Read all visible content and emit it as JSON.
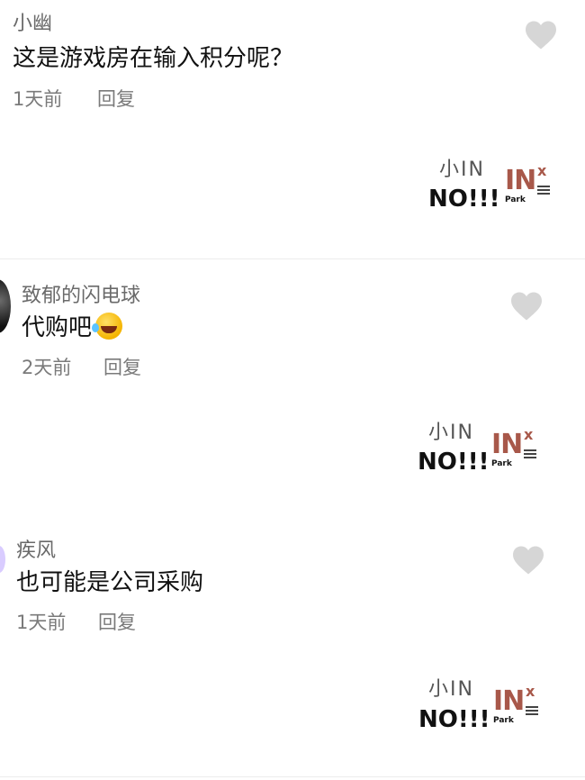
{
  "comments": [
    {
      "username": "小幽",
      "text": "这是游戏房在输入积分呢？",
      "time": "1天前",
      "reply": "回复",
      "has_emoji": false,
      "reply_sig": {
        "name": "小IN",
        "text": "NO!!!"
      }
    },
    {
      "username": "致郁的闪电球",
      "text": "代购吧",
      "time": "2天前",
      "reply": "回复",
      "has_emoji": true,
      "reply_sig": {
        "name": "小IN",
        "text": "NO!!!"
      }
    },
    {
      "username": "疾风",
      "text": "也可能是公司采购",
      "time": "1天前",
      "reply": "回复",
      "has_emoji": false,
      "reply_sig": {
        "name": "小IN",
        "text": "NO!!!"
      }
    }
  ],
  "logo": {
    "main": "IN",
    "superscript": "x",
    "sub": "Park"
  },
  "icons": {
    "like": "heart-icon",
    "emoji": "rolling-laughing-emoji"
  },
  "colors": {
    "brand": "#a8584a",
    "like": "#d6d6d6",
    "meta": "#7a7a7a"
  }
}
